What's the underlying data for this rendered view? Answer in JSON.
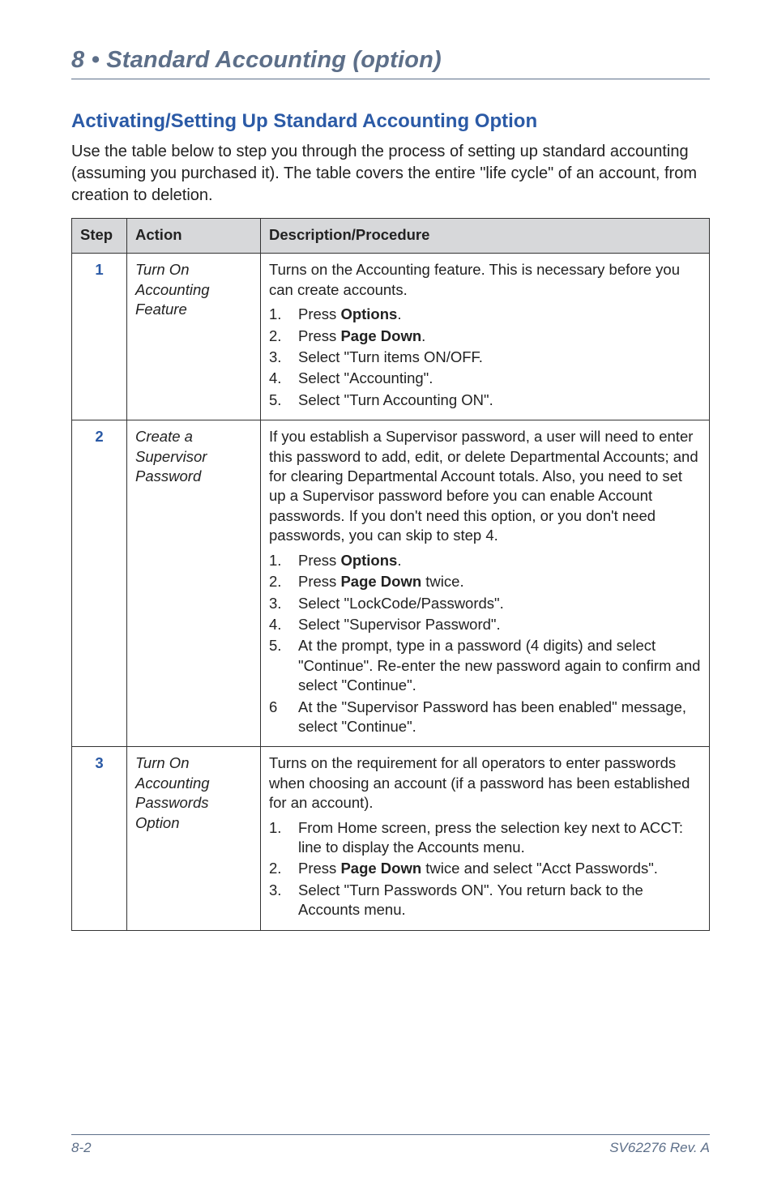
{
  "chapter_title": "8 • Standard Accounting (option)",
  "section_heading": "Activating/Setting Up Standard Accounting Option",
  "intro": "Use the table below to step you through the process of setting up standard accounting (assuming you purchased it). The table covers the entire \"life cycle\" of an account, from creation to deletion.",
  "headers": {
    "step": "Step",
    "action": "Action",
    "desc": "Description/Procedure"
  },
  "rows": [
    {
      "num": "1",
      "action": "Turn On Accounting Feature",
      "lead": "Turns on the Accounting feature. This is necessary before you can create accounts.",
      "steps": [
        {
          "n": "1.",
          "pre": "Press ",
          "bold": "Options",
          "post": "."
        },
        {
          "n": "2.",
          "pre": "Press ",
          "bold": "Page Down",
          "post": "."
        },
        {
          "n": "3.",
          "text": "Select \"Turn items ON/OFF."
        },
        {
          "n": "4.",
          "text": "Select \"Accounting\"."
        },
        {
          "n": "5.",
          "text": "Select \"Turn Accounting ON\"."
        }
      ]
    },
    {
      "num": "2",
      "action": "Create a Supervisor Password",
      "lead": "If you establish a Supervisor password, a user will need to enter this password to add, edit, or delete Departmental Accounts; and for clearing Departmental Account totals. Also, you need to set up a Supervisor password before you can enable Account passwords. If you don't need this option, or you don't need passwords, you can skip to step 4.",
      "steps": [
        {
          "n": "1.",
          "pre": "Press ",
          "bold": "Options",
          "post": "."
        },
        {
          "n": "2.",
          "pre": "Press ",
          "bold": "Page Down",
          "post": " twice."
        },
        {
          "n": "3.",
          "text": "Select \"LockCode/Passwords\"."
        },
        {
          "n": "4.",
          "text": "Select \"Supervisor Password\"."
        },
        {
          "n": "5.",
          "text": "At the prompt, type in a password (4 digits) and select \"Continue\". Re-enter the new password again to confirm and select \"Continue\"."
        },
        {
          "n": "6",
          "text": "At the \"Supervisor Password has been enabled\" message, select \"Continue\"."
        }
      ]
    },
    {
      "num": "3",
      "action": "Turn On Accounting Passwords Option",
      "lead": "Turns on the requirement for all operators to enter passwords when choosing an account (if a password has been established for an account).",
      "steps": [
        {
          "n": "1.",
          "text": "From Home screen, press the selection key next to ACCT: line to display the Accounts menu."
        },
        {
          "n": "2.",
          "pre": "Press ",
          "bold": "Page Down",
          "post": " twice and select \"Acct Passwords\"."
        },
        {
          "n": "3.",
          "text": "Select \"Turn Passwords ON\". You return back to the Accounts menu."
        }
      ]
    }
  ],
  "footer": {
    "left": "8-2",
    "right": "SV62276 Rev. A"
  }
}
